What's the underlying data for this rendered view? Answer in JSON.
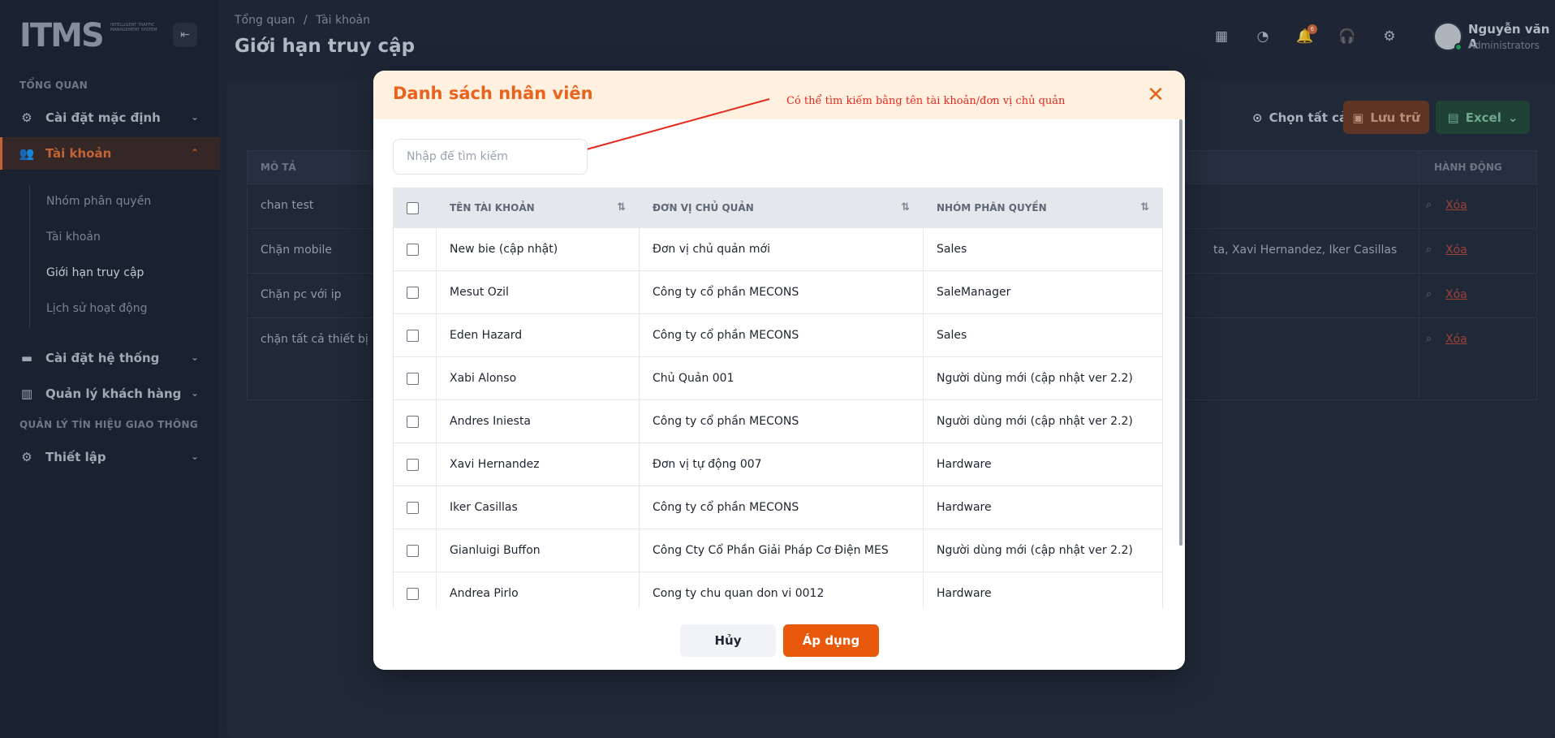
{
  "brand": {
    "logo_text": "ITMS",
    "logo_tagline": "Intelligent Traffic Management System"
  },
  "sidebar": {
    "section_overview": "TỔNG QUAN",
    "section_traffic": "QUẢN LÝ TÍN HIỆU GIAO THÔNG",
    "items": [
      {
        "label": "Cài đặt mặc định",
        "icon": "gear-icon"
      },
      {
        "label": "Tài khoản",
        "icon": "users-icon"
      },
      {
        "label": "Cài đặt hệ thống",
        "icon": "card-icon"
      },
      {
        "label": "Quản lý khách hàng",
        "icon": "building-icon"
      },
      {
        "label": "Thiết lập",
        "icon": "gear-icon"
      }
    ],
    "subitems": [
      "Nhóm phân quyền",
      "Tài khoản",
      "Giới hạn truy cập",
      "Lịch sử hoạt động"
    ]
  },
  "header": {
    "breadcrumb_home": "Tổng quan",
    "breadcrumb_sep": "/",
    "breadcrumb_current": "Tài khoản",
    "title": "Giới hạn truy cập",
    "notification_count": "6",
    "user_name": "Nguyễn văn A",
    "user_role": "Administrators"
  },
  "toolbar": {
    "select_all": "Chọn tất cả",
    "save": "Lưu trữ",
    "excel": "Excel"
  },
  "bg_table": {
    "col_desc": "MÔ TẢ",
    "col_action": "HÀNH ĐỘNG",
    "delete_label": "Xóa",
    "rows": [
      {
        "desc": "chan test",
        "extra": ""
      },
      {
        "desc": "Chặn mobile",
        "extra": "ta, Xavi Hernandez, Iker Casillas"
      },
      {
        "desc": "Chặn pc với ip",
        "extra": ""
      },
      {
        "desc": "chặn tất cả thiết bị",
        "extra": ""
      }
    ]
  },
  "modal": {
    "title": "Danh sách nhân viên",
    "annotation": "Có thể tìm kiếm bằng tên tài khoản/đơn vị chủ quản",
    "search_placeholder": "Nhập để tìm kiếm",
    "columns": [
      "TÊN TÀI KHOẢN",
      "ĐƠN VỊ CHỦ QUẢN",
      "NHÓM PHÂN QUYỀN"
    ],
    "rows": [
      {
        "name": "New bie (cập nhật)",
        "unit": "Đơn vị chủ quản mới",
        "group": "Sales"
      },
      {
        "name": "Mesut Ozil",
        "unit": "Công ty cổ phần MECONS",
        "group": "SaleManager"
      },
      {
        "name": "Eden Hazard",
        "unit": "Công ty cổ phần MECONS",
        "group": "Sales"
      },
      {
        "name": "Xabi Alonso",
        "unit": "Chủ Quản 001",
        "group": "Người dùng mới (cập nhật ver 2.2)"
      },
      {
        "name": "Andres Iniesta",
        "unit": "Công ty cổ phần MECONS",
        "group": "Người dùng mới (cập nhật ver 2.2)"
      },
      {
        "name": "Xavi Hernandez",
        "unit": "Đơn vị tự động 007",
        "group": "Hardware"
      },
      {
        "name": "Iker Casillas",
        "unit": "Công ty cổ phần MECONS",
        "group": "Hardware"
      },
      {
        "name": "Gianluigi Buffon",
        "unit": "Công Cty Cổ Phần Giải Pháp Cơ Điện MES",
        "group": "Người dùng mới (cập nhật ver 2.2)"
      },
      {
        "name": "Andrea Pirlo",
        "unit": "Cong ty chu quan don vi 0012",
        "group": "Hardware"
      }
    ],
    "cancel_label": "Hủy",
    "apply_label": "Áp dụng"
  },
  "colors": {
    "accent": "#e8590c",
    "modal_header_bg": "#fff0df",
    "annotation": "#e32b1f"
  }
}
